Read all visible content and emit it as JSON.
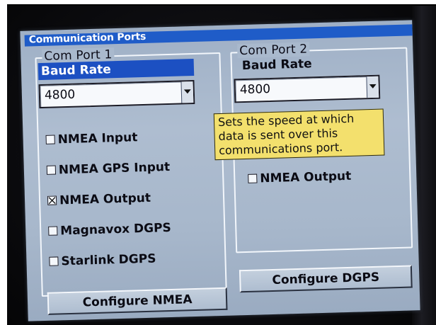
{
  "window": {
    "title": "Communication Ports"
  },
  "com_port_1": {
    "group_label": "Com Port 1",
    "baud_label": "Baud Rate",
    "baud_value": "4800",
    "options": [
      {
        "label": "NMEA Input",
        "checked": false
      },
      {
        "label": "NMEA GPS Input",
        "checked": false
      },
      {
        "label": "NMEA Output",
        "checked": true
      },
      {
        "label": "Magnavox DGPS",
        "checked": false
      },
      {
        "label": "Starlink DGPS",
        "checked": false
      }
    ],
    "configure_button": "Configure NMEA"
  },
  "com_port_2": {
    "group_label": "Com Port 2",
    "baud_label": "Baud Rate",
    "baud_value": "4800",
    "options": [
      {
        "label": "NMEA Output",
        "checked": false
      }
    ],
    "configure_button": "Configure DGPS"
  },
  "tooltip": {
    "lines": [
      "Sets the speed at which",
      "data is sent over this",
      "communications port."
    ]
  },
  "colors": {
    "titlebar": "#1f5cc8",
    "screen": "#a9b9cd",
    "tooltip": "#f3e06d"
  }
}
